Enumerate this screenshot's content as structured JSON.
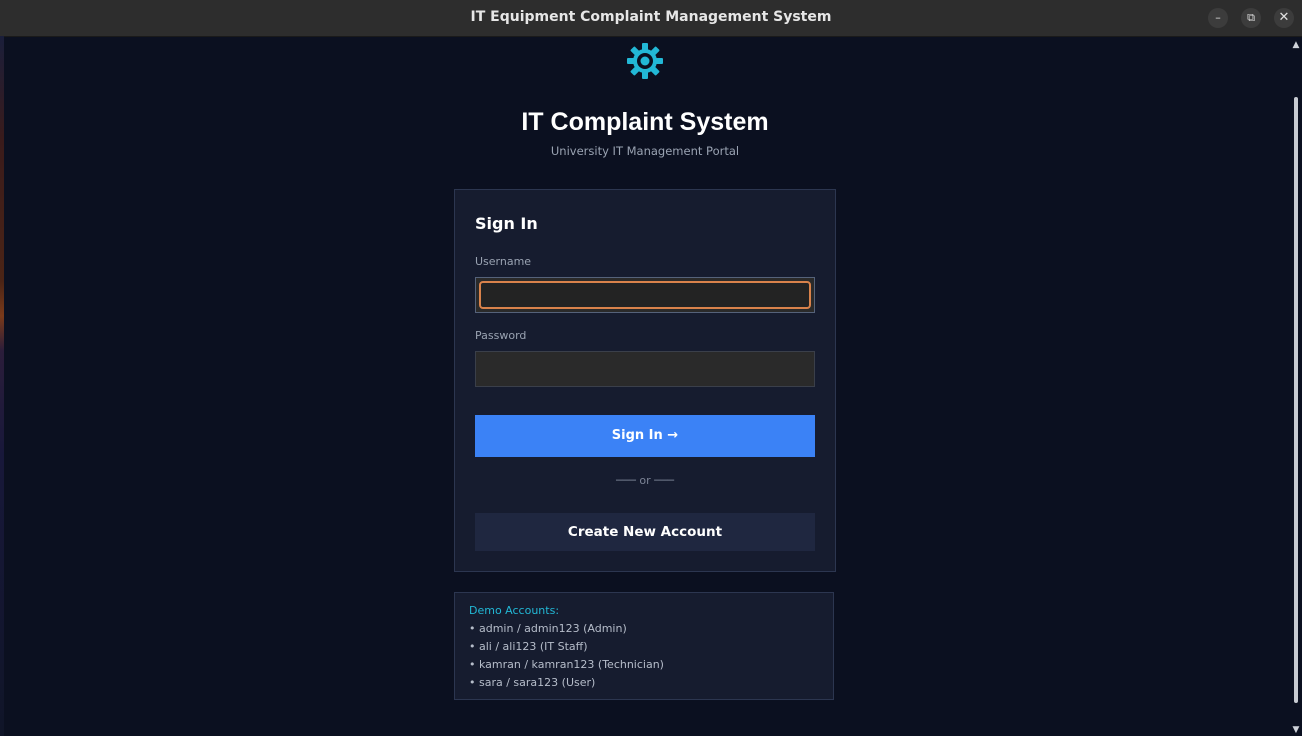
{
  "window": {
    "title": "IT Equipment Complaint Management System",
    "minimize": "–",
    "maximize": "⧉",
    "close": "✕"
  },
  "colors": {
    "accent_blue": "#3b82f6",
    "gear_cyan": "#22b8d6",
    "focus_orange": "#d9824b",
    "background": "#0b1020"
  },
  "header": {
    "icon": "gear-icon",
    "title": "IT Complaint System",
    "subtitle": "University IT Management Portal"
  },
  "login": {
    "heading": "Sign In",
    "username_label": "Username",
    "username_value": "",
    "password_label": "Password",
    "password_value": "",
    "submit_label": "Sign In →",
    "divider_text": "─── or ───",
    "create_account_label": "Create New Account"
  },
  "demo": {
    "title": "Demo Accounts:",
    "items": [
      "• admin / admin123  (Admin)",
      "• ali / ali123  (IT Staff)",
      "• kamran / kamran123  (Technician)",
      "• sara / sara123  (User)"
    ]
  }
}
